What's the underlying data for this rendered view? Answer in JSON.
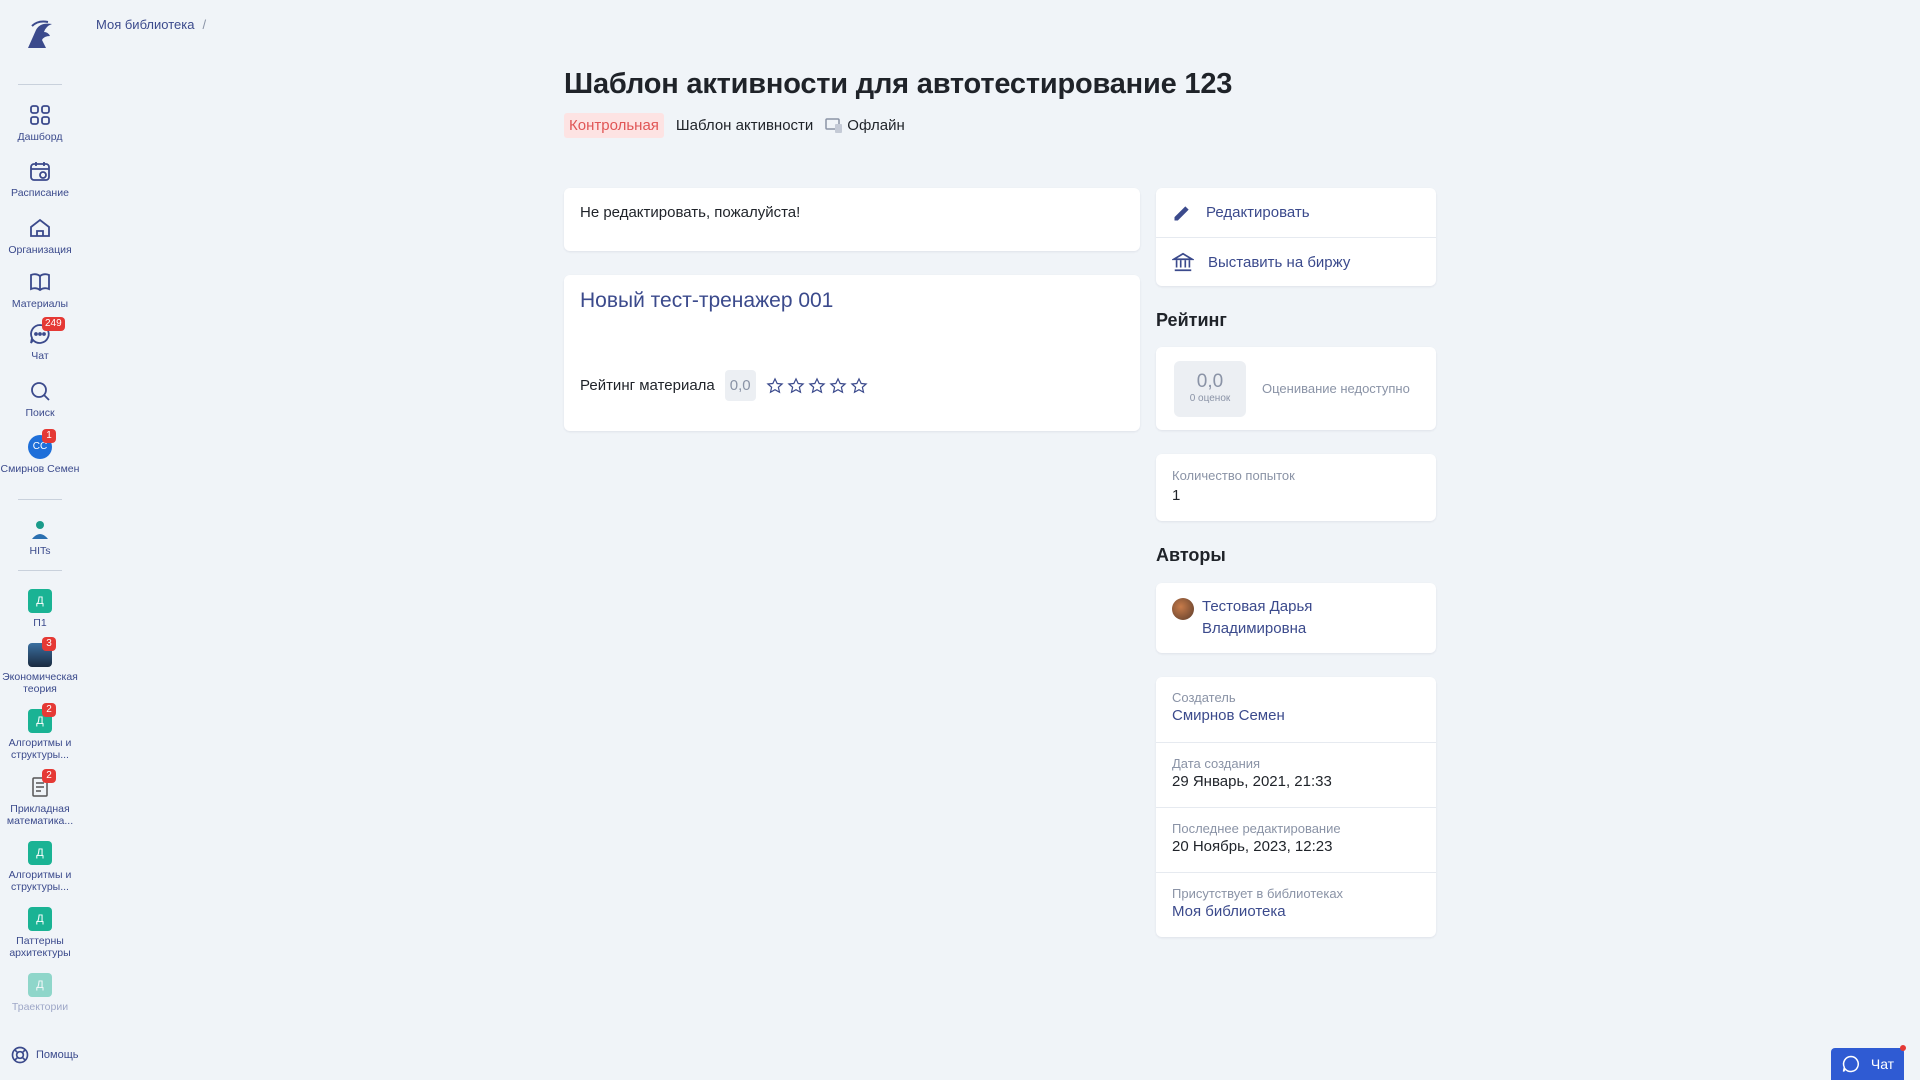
{
  "breadcrumb": {
    "items": [
      "Моя библиотека"
    ],
    "separator": "/"
  },
  "sidebar": {
    "items": [
      {
        "label": "Дашборд",
        "icon": "grid-icon"
      },
      {
        "label": "Расписание",
        "icon": "calendar-icon"
      },
      {
        "label": "Организация",
        "icon": "home-icon"
      },
      {
        "label": "Материалы",
        "icon": "book-icon"
      },
      {
        "label": "Чат",
        "icon": "chat-icon",
        "badge": "249"
      },
      {
        "label": "Поиск",
        "icon": "search-icon"
      },
      {
        "label": "Смирнов Семен",
        "avatar": "СС",
        "badge": "1"
      },
      {
        "label": "HITs",
        "icon": "hits-logo-icon"
      },
      {
        "label": "П1",
        "tile": "Д"
      },
      {
        "label": "Экономическая теория",
        "badge": "3"
      },
      {
        "label": "Алгоритмы и структуры...",
        "tile": "Д",
        "badge": "2"
      },
      {
        "label": "Прикладная математика...",
        "badge": "2"
      },
      {
        "label": "Алгоритмы и структуры...",
        "tile": "Д"
      },
      {
        "label": "Паттерны архитектуры",
        "tile": "Д"
      },
      {
        "label": "Траектории",
        "tile": "Д"
      }
    ],
    "help_label": "Помощь"
  },
  "header": {
    "title": "Шаблон активности для автотестирование 123",
    "tags": {
      "control": "Контрольная",
      "type": "Шаблон активности",
      "mode": "Офлайн"
    }
  },
  "description": "Не редактировать, пожалуйста!",
  "material": {
    "title": "Новый тест-тренажер 001",
    "rating_label": "Рейтинг материала",
    "rating_value": "0,0",
    "stars": 0
  },
  "actions": {
    "edit": "Редактировать",
    "publish": "Выставить на биржу"
  },
  "rating": {
    "heading": "Рейтинг",
    "value": "0,0",
    "count": "0 оценок",
    "note": "Оценивание недоступно"
  },
  "attempts": {
    "label": "Количество попыток",
    "value": "1"
  },
  "authors": {
    "heading": "Авторы",
    "list": [
      "Тестовая Дарья Владимировна"
    ]
  },
  "meta": {
    "creator_label": "Создатель",
    "creator": "Смирнов Семен",
    "created_label": "Дата создания",
    "created": "29 Январь, 2021, 21:33",
    "edited_label": "Последнее редактирование",
    "edited": "20 Ноябрь, 2023, 12:23",
    "libraries_label": "Присутствует в библиотеках",
    "libraries": "Моя библиотека"
  },
  "chat_button": "Чат",
  "colors": {
    "accent": "#3b4a8c",
    "badge": "#e53935",
    "tile": "#1ab394",
    "chat": "#2f5bd3"
  }
}
